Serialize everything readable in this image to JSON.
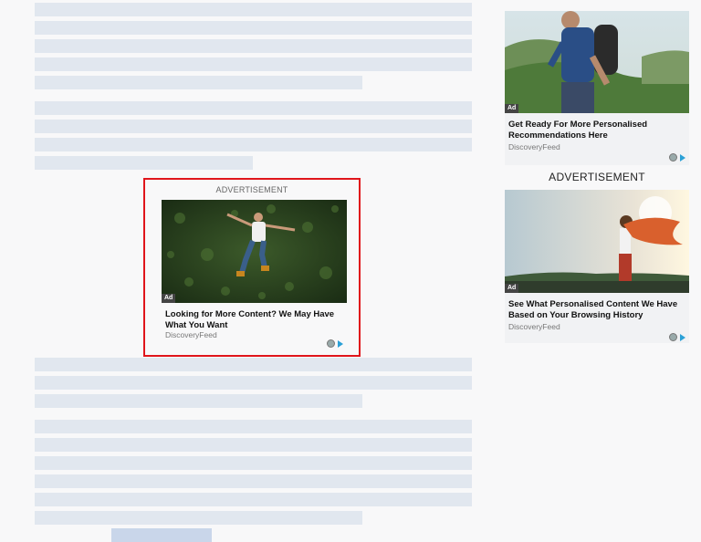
{
  "main_ad": {
    "label": "ADVERTISEMENT",
    "badge": "Ad",
    "title": "Looking for More Content? We May Have What You Want",
    "source": "DiscoveryFeed",
    "icons": [
      "adchoices-icon",
      "info-triangle-icon"
    ]
  },
  "sidebar": {
    "ad_label": "ADVERTISEMENT",
    "cards": [
      {
        "badge": "Ad",
        "title": "Get Ready For More Personalised Recommendations Here",
        "source": "DiscoveryFeed"
      },
      {
        "badge": "Ad",
        "title": "See What Personalised Content We Have Based on Your Browsing History",
        "source": "DiscoveryFeed"
      }
    ]
  },
  "colors": {
    "placeholder_bar": "#e1e7ef",
    "highlight_border": "#e0151b",
    "adchoices": "#2aa0d6"
  }
}
